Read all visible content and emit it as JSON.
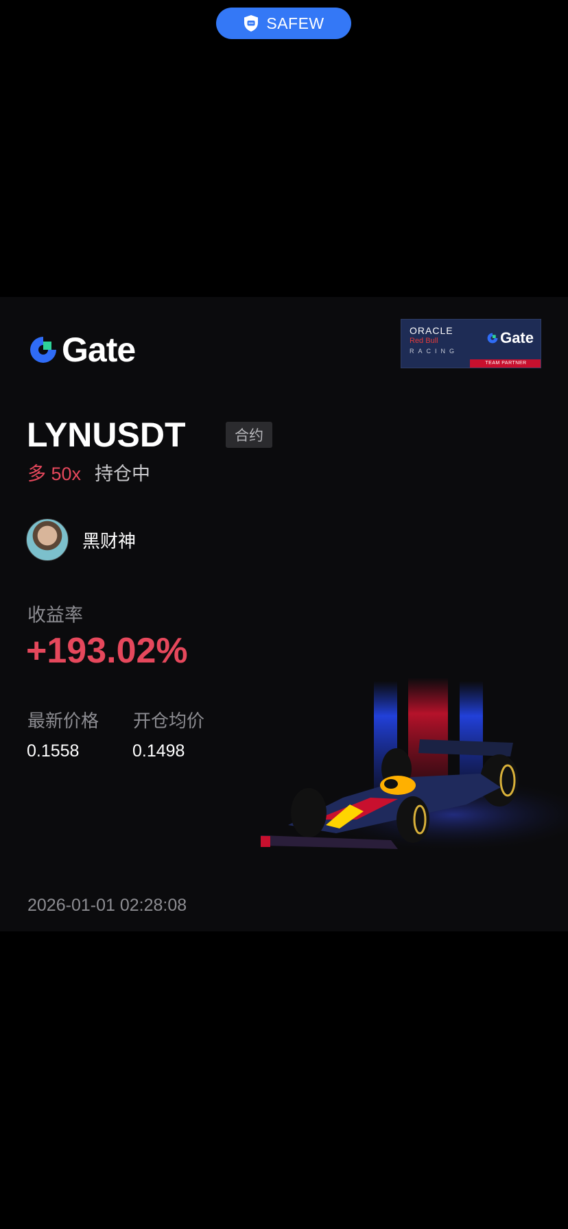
{
  "top_badge": {
    "label": "SAFEW",
    "icon": "shield-chat-icon",
    "color": "#3478f6"
  },
  "card": {
    "brand": "Gate",
    "partner_badge": {
      "line1": "ORACLE",
      "line2": "Red Bull",
      "line3": "RACING",
      "brand": "Gate",
      "footer": "TEAM PARTNER"
    },
    "pair": "LYNUSDT",
    "contract_tag": "合约",
    "side": "多 50x",
    "position_status": "持仓中",
    "user_name": "黑财神",
    "yield_label": "收益率",
    "yield_value": "+193.02%",
    "latest_price_label": "最新价格",
    "latest_price": "0.1558",
    "entry_price_label": "开仓均价",
    "entry_price": "0.1498",
    "timestamp": "2026-01-01 02:28:08",
    "colors": {
      "profit": "#e6485c",
      "muted": "#8d8d92",
      "background": "#0b0b0d"
    }
  }
}
